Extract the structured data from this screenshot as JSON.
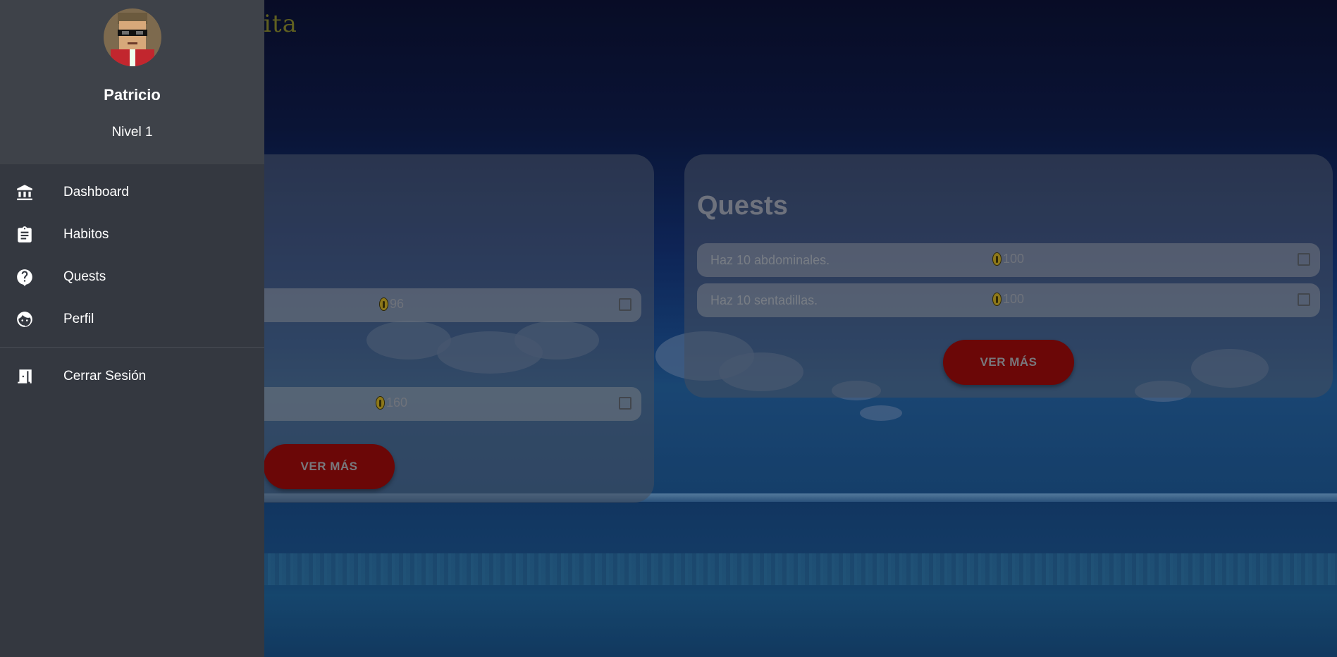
{
  "app": {
    "brand_partial": "abita"
  },
  "user": {
    "name": "Patricio",
    "level": "Nivel 1"
  },
  "nav": {
    "items": [
      {
        "label": "Dashboard",
        "icon": "bank-icon"
      },
      {
        "label": "Habitos",
        "icon": "clipboard-icon"
      },
      {
        "label": "Quests",
        "icon": "question-icon"
      },
      {
        "label": "Perfil",
        "icon": "face-icon"
      }
    ],
    "logout": {
      "label": "Cerrar Sesión",
      "icon": "exit-door-icon"
    }
  },
  "habits_card": {
    "items": [
      {
        "points": "96",
        "checked": false
      },
      {
        "points": "160",
        "checked": false
      }
    ],
    "more_label": "VER MÁS"
  },
  "quests_card": {
    "title": "Quests",
    "items": [
      {
        "text": "Haz 10 abdominales.",
        "points": "100",
        "checked": false
      },
      {
        "text": "Haz 10 sentadillas.",
        "points": "100",
        "checked": false
      }
    ],
    "more_label": "VER MÁS"
  },
  "colors": {
    "drawer_bg": "#343840",
    "drawer_head_bg": "#3e4249",
    "button_red": "#8a0909",
    "coin_gold": "#b59a22"
  }
}
